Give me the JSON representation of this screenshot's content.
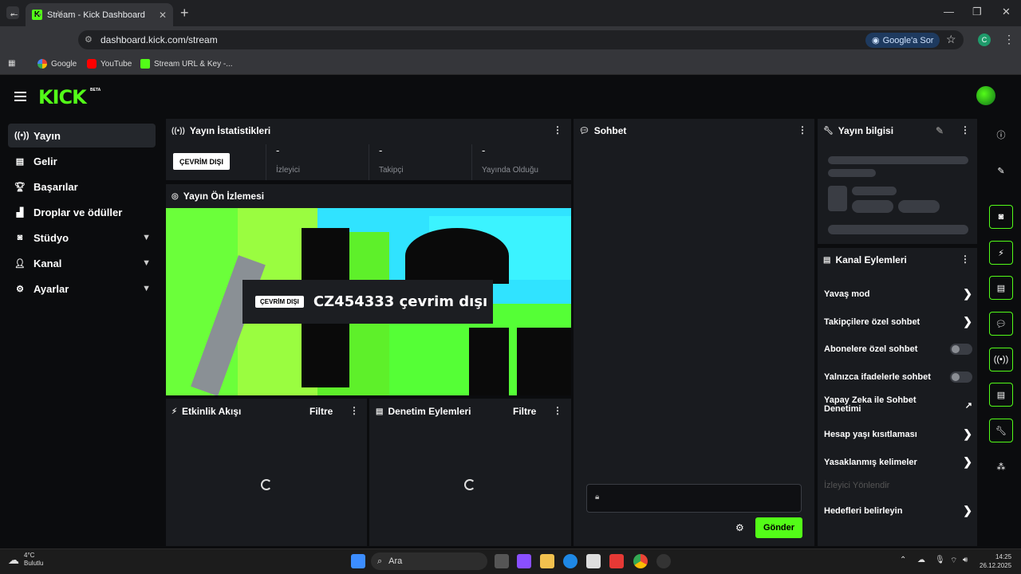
{
  "browser": {
    "tab_title": "Stream - Kick Dashboard",
    "url": "dashboard.kick.com/stream",
    "google_sor": "Google'a Sor",
    "profile_initial": "C",
    "bookmarks": [
      "Google",
      "YouTube",
      "Stream URL & Key -..."
    ]
  },
  "header": {
    "logo": "KICK",
    "beta": "BETA"
  },
  "sidebar": {
    "items": [
      {
        "label": "Yayın",
        "icon": "stream-icon"
      },
      {
        "label": "Gelir",
        "icon": "revenue-icon"
      },
      {
        "label": "Başarılar",
        "icon": "trophy-icon"
      },
      {
        "label": "Droplar ve ödüller",
        "icon": "drops-icon"
      },
      {
        "label": "Stüdyo",
        "icon": "studio-icon"
      },
      {
        "label": "Kanal",
        "icon": "channel-icon"
      },
      {
        "label": "Ayarlar",
        "icon": "gear-icon"
      }
    ]
  },
  "stats": {
    "title": "Yayın İstatistikleri",
    "status": "ÇEVRİM DIŞI",
    "cols": [
      {
        "value": "-",
        "label": "İzleyici"
      },
      {
        "value": "-",
        "label": "Takipçi"
      },
      {
        "value": "-",
        "label": "Yayında Olduğu"
      }
    ]
  },
  "preview": {
    "title": "Yayın Ön İzlemesi",
    "tag": "ÇEVRİM DIŞI",
    "text": "CZ454333 çevrim dışı"
  },
  "activity": {
    "title": "Etkinlik Akışı",
    "filter": "Filtre"
  },
  "moderation": {
    "title": "Denetim Eylemleri",
    "filter": "Filtre"
  },
  "chat": {
    "title": "Sohbet",
    "send": "Gönder"
  },
  "stream_info": {
    "title": "Yayın bilgisi"
  },
  "channel_actions": {
    "title": "Kanal Eylemleri",
    "items": [
      {
        "label": "Yavaş mod"
      },
      {
        "label": "Takipçilere özel sohbet"
      },
      {
        "label": "Abonelere özel sohbet"
      },
      {
        "label": "Yalnızca ifadelerle sohbet"
      },
      {
        "label": "Yapay Zeka ile Sohbet Denetimi"
      },
      {
        "label": "Hesap yaşı kısıtlaması"
      },
      {
        "label": "Yasaklanmış kelimeler"
      },
      {
        "label": "İzleyici Yönlendir"
      },
      {
        "label": "Hedefleri belirleyin"
      }
    ]
  },
  "taskbar": {
    "weather_temp": "4°C",
    "weather_desc": "Bulutlu",
    "search": "Ara",
    "time": "14:25",
    "date": "26.12.2025"
  },
  "colors": {
    "accent": "#53fc18",
    "panel": "#191b1f",
    "bg": "#0b0c0e"
  }
}
